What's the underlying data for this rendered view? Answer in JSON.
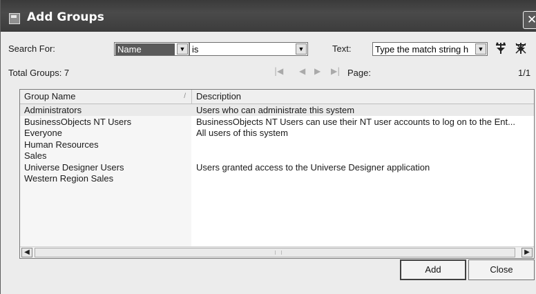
{
  "window": {
    "title": "Add Groups",
    "close_glyph": "✕"
  },
  "search": {
    "label": "Search For:",
    "field_value": "Name",
    "operator_value": "is",
    "text_label": "Text:",
    "text_placeholder": "Type the match string h"
  },
  "summary": {
    "total_label": "Total Groups:  7"
  },
  "pager": {
    "first": "|◀",
    "prev": "◀",
    "next": "▶",
    "last": "▶|",
    "page_label": "Page:",
    "page_value": "1/1"
  },
  "table": {
    "columns": [
      "Group Name",
      "Description"
    ],
    "sort_glyph": "/",
    "rows": [
      {
        "name": "Administrators",
        "description": "Users who can administrate this system"
      },
      {
        "name": "BusinessObjects NT Users",
        "description": "BusinessObjects NT Users can use their NT user accounts to log on to the Ent..."
      },
      {
        "name": "Everyone",
        "description": "All users of this system"
      },
      {
        "name": "Human Resources",
        "description": ""
      },
      {
        "name": "Sales",
        "description": ""
      },
      {
        "name": "Universe Designer Users",
        "description": "Users granted access to the Universe Designer application"
      },
      {
        "name": "Western Region Sales",
        "description": ""
      }
    ]
  },
  "scroll": {
    "left": "◀",
    "right": "▶"
  },
  "buttons": {
    "add": "Add",
    "close": "Close"
  },
  "icons": {
    "dropdown": "▼",
    "filter": "filter-icon",
    "clear_filter": "clear-filter-icon"
  }
}
